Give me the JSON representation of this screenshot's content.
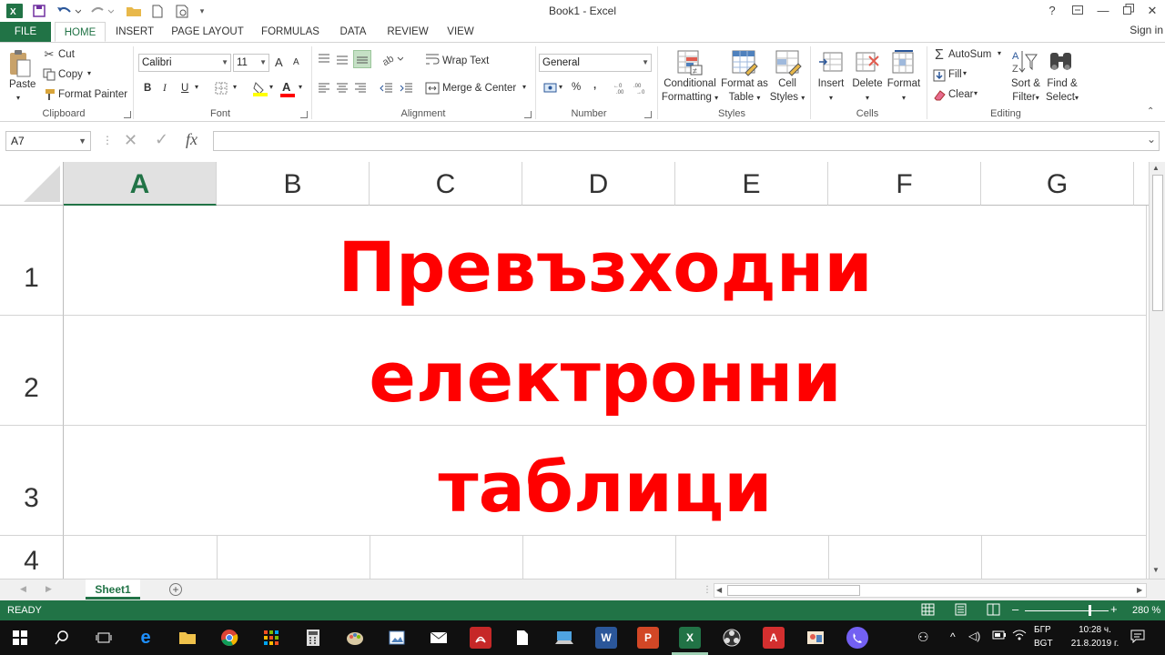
{
  "window": {
    "title": "Book1 - Excel"
  },
  "qat": {
    "save": "save-icon",
    "undo": "undo-icon",
    "redo": "redo-icon"
  },
  "tabs": [
    {
      "label": "FILE"
    },
    {
      "label": "HOME"
    },
    {
      "label": "INSERT"
    },
    {
      "label": "PAGE LAYOUT"
    },
    {
      "label": "FORMULAS"
    },
    {
      "label": "DATA"
    },
    {
      "label": "REVIEW"
    },
    {
      "label": "VIEW"
    }
  ],
  "signin": "Sign in",
  "ribbon": {
    "clipboard": {
      "paste": "Paste",
      "cut": "Cut",
      "copy": "Copy",
      "format_painter": "Format Painter",
      "label": "Clipboard"
    },
    "font": {
      "name": "Calibri",
      "size": "11",
      "bold": "B",
      "italic": "I",
      "underline": "U",
      "grow": "A",
      "shrink": "A",
      "color_a": "A",
      "label": "Font"
    },
    "alignment": {
      "wrap": "Wrap Text",
      "merge": "Merge & Center",
      "label": "Alignment"
    },
    "number": {
      "format": "General",
      "percent": "%",
      "comma": ",",
      "label": "Number"
    },
    "styles": {
      "conditional_1": "Conditional",
      "conditional_2": "Formatting",
      "format_table_1": "Format as",
      "format_table_2": "Table",
      "cell_styles_1": "Cell",
      "cell_styles_2": "Styles",
      "label": "Styles"
    },
    "cells": {
      "insert": "Insert",
      "delete": "Delete",
      "format": "Format",
      "label": "Cells"
    },
    "editing": {
      "autosum": "AutoSum",
      "fill": "Fill",
      "clear": "Clear",
      "sort_1": "Sort &",
      "sort_2": "Filter",
      "find_1": "Find &",
      "find_2": "Select",
      "label": "Editing"
    }
  },
  "formula_bar": {
    "name_box": "A7",
    "fx": "fx",
    "value": ""
  },
  "grid": {
    "columns": [
      "A",
      "B",
      "C",
      "D",
      "E",
      "F",
      "G"
    ],
    "selected_column": "A",
    "rows": [
      "1",
      "2",
      "3",
      "4"
    ],
    "text_lines": [
      "Превъзходни",
      "електронни",
      "таблици"
    ],
    "text_color": "#ff0000"
  },
  "sheets": {
    "active": "Sheet1"
  },
  "status": {
    "ready": "READY",
    "zoom": "280 %"
  },
  "taskbar": {
    "lang_1": "БГР",
    "lang_2": "BGT",
    "time": "10:28 ч.",
    "date": "21.8.2019 г."
  },
  "colors": {
    "accent": "#217346",
    "text_red": "#ff0000"
  }
}
